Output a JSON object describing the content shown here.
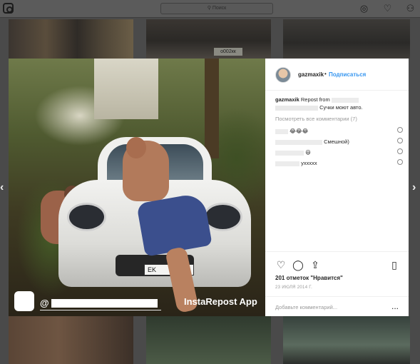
{
  "topbar": {
    "search_placeholder": "Поиск",
    "icons": [
      "instagram-logo-icon",
      "search-icon",
      "compass-icon",
      "heart-icon",
      "profile-icon"
    ]
  },
  "background": {
    "plate_text": "о002кк"
  },
  "post": {
    "watermark_user": "@",
    "watermark_app": "InstaRepost App",
    "plate": "EK"
  },
  "panel": {
    "username": "gazmaxik",
    "follow_label": "Подписаться",
    "caption_user": "gazmaxik",
    "caption_text": "Repost from",
    "caption_line2": "Сучки моют авто.",
    "view_all": "Посмотреть все комментарии (7)",
    "comments": [
      {
        "text": "😂😂😂"
      },
      {
        "text": "Смешной)"
      },
      {
        "text": "😃"
      },
      {
        "text": "уххххх"
      }
    ],
    "likes": "201 отметок \"Нравится\"",
    "date": "23 ИЮЛЯ 2014 Г.",
    "add_comment_placeholder": "Добавьте комментарий...",
    "more_label": "..."
  },
  "colors": {
    "follow": "#3897f0",
    "overlay": "#4a4a4a",
    "text": "#262626"
  }
}
